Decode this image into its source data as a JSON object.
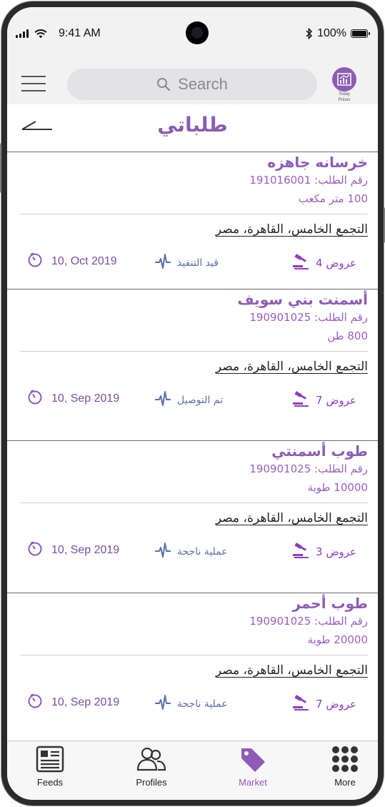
{
  "status_bar": {
    "time": "9:41 AM",
    "battery": "100%"
  },
  "header": {
    "search_placeholder": "Search",
    "today_prices_line1": "Today",
    "today_prices_line2": "Prices"
  },
  "page": {
    "title": "طلباتي"
  },
  "orders": [
    {
      "title": "خرسانه جاهزه",
      "order_number": "رقم الطلب: 191016001",
      "quantity": "100 متر مكعب",
      "address": "التجمع الخامس، القاهرة، مصر",
      "date": "10, Oct 2019",
      "status": "قيد التنفيذ",
      "offers": "عروض 4"
    },
    {
      "title": "أسمنت بني سويف",
      "order_number": "رقم الطلب: 190901025",
      "quantity": "800 طن",
      "address": "التجمع الخامس، القاهرة، مصر",
      "date": "10, Sep 2019",
      "status": "تم التوصيل",
      "offers": "عروض 7"
    },
    {
      "title": "طوب أسمنتي",
      "order_number": "رقم الطلب: 190901025",
      "quantity": "10000 طوبة",
      "address": "التجمع الخامس، القاهرة، مصر",
      "date": "10, Sep 2019",
      "status": "عملية ناجحة",
      "offers": "عروض 3"
    },
    {
      "title": "طوب أحمر",
      "order_number": "رقم الطلب: 190901025",
      "quantity": "20000 طوبة",
      "address": "التجمع الخامس، القاهرة، مصر",
      "date": "10, Sep 2019",
      "status": "عملية ناجحة",
      "offers": "عروض 7"
    }
  ],
  "tab_bar": {
    "feeds": "Feeds",
    "profiles": "Profiles",
    "market": "Market",
    "more": "More",
    "active": "market"
  },
  "colors": {
    "accent": "#8d5db5",
    "status_blue": "#5c6fa8",
    "offers_purple": "#8d3fc0"
  }
}
